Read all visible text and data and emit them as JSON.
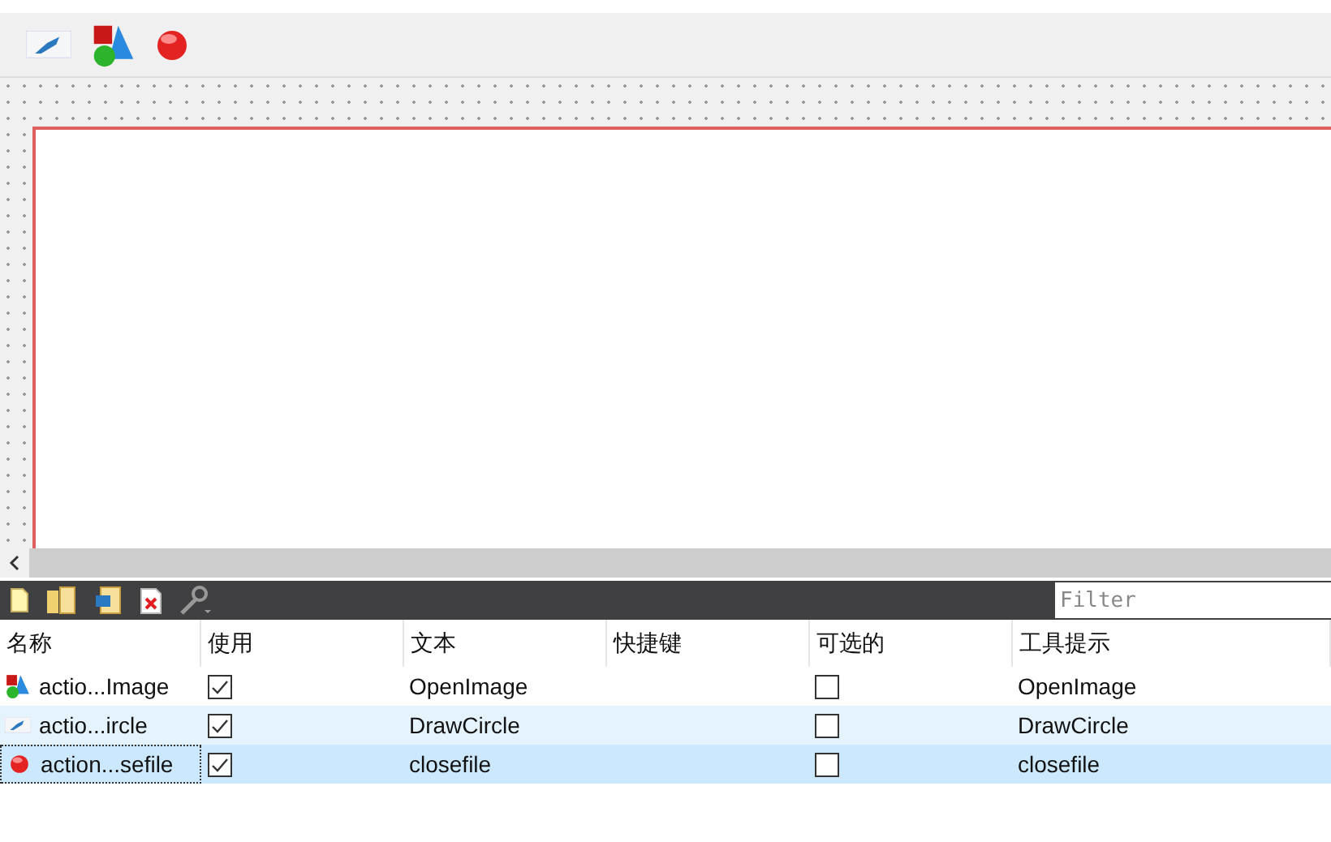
{
  "toolbar": {
    "actions": [
      {
        "kind": "chart"
      },
      {
        "kind": "shapes"
      },
      {
        "kind": "ball"
      }
    ]
  },
  "action_editor": {
    "filter": {
      "placeholder": "Filter"
    },
    "columns": [
      "名称",
      "使用",
      "文本",
      "快捷键",
      "可选的",
      "工具提示"
    ],
    "rows": [
      {
        "kind": "shapes",
        "name": "actio...Image",
        "used": true,
        "text": "OpenImage",
        "checkable": false,
        "tooltip": "OpenImage",
        "selected": false
      },
      {
        "kind": "chart",
        "name": "actio...ircle",
        "used": true,
        "text": "DrawCircle",
        "checkable": false,
        "tooltip": "DrawCircle",
        "selected": false
      },
      {
        "kind": "ball",
        "name": "action...sefile",
        "used": true,
        "text": "closefile",
        "checkable": false,
        "tooltip": "closefile",
        "selected": true
      }
    ]
  }
}
